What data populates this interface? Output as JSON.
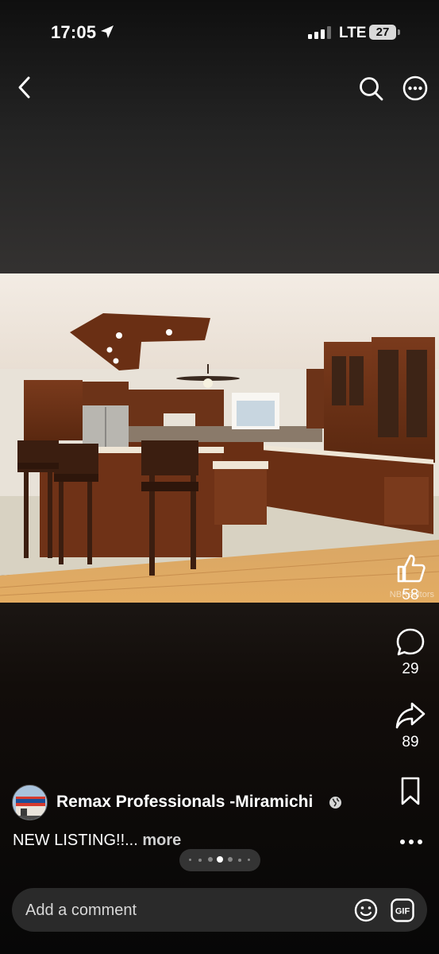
{
  "status_bar": {
    "time": "17:05",
    "network": "LTE",
    "battery": "27",
    "icons": [
      "location-arrow-icon",
      "signal-icon",
      "battery-icon"
    ]
  },
  "nav": {
    "icons": [
      "back-chevron-icon",
      "search-icon",
      "more-circle-icon"
    ]
  },
  "photo": {
    "description_icon": "kitchen-photo",
    "watermark": "NBRealtors"
  },
  "actions": {
    "like_count": "58",
    "comment_count": "29",
    "share_count": "89",
    "icons": [
      "thumbs-up-icon",
      "comment-icon",
      "share-icon",
      "bookmark-icon",
      "more-dots-icon"
    ]
  },
  "post": {
    "account_name": "Remax Professionals -Miramichi",
    "caption": "NEW LISTING!!...",
    "more_label": "more"
  },
  "comment": {
    "placeholder": "Add a comment"
  },
  "colors": {
    "accent": "#ffffff",
    "comment_bg": "#2a2a2a"
  }
}
